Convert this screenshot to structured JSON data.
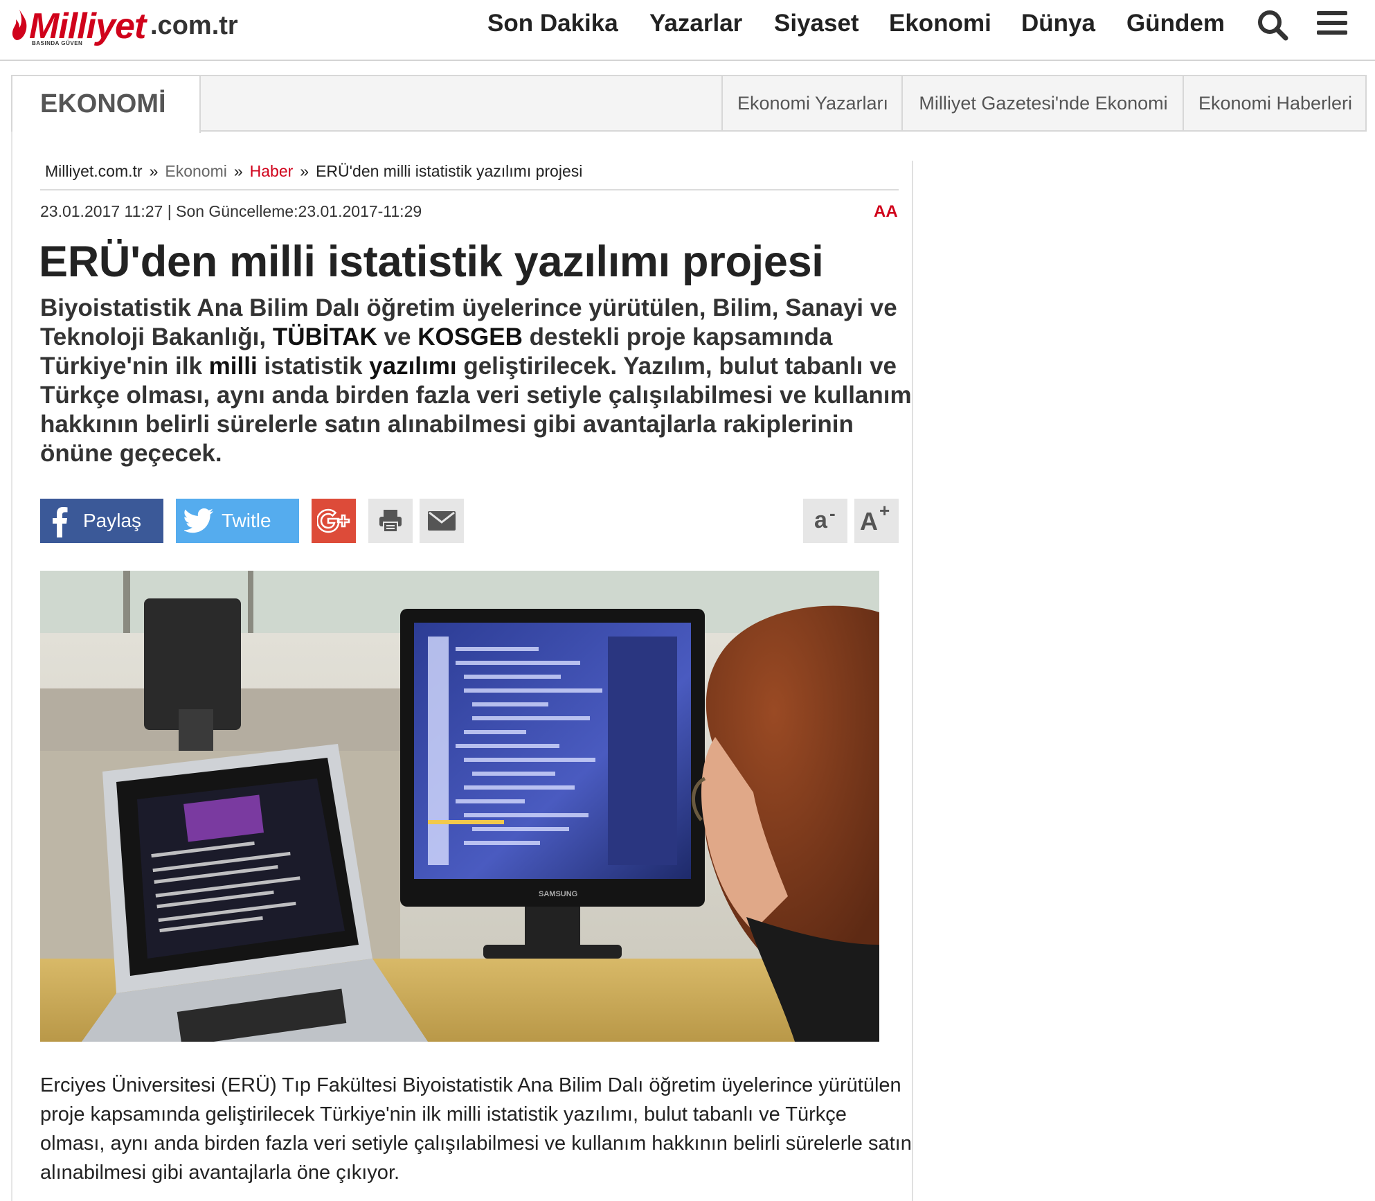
{
  "header": {
    "logo_brand": "Milliyet",
    "logo_tld": ".com.tr",
    "logo_motto": "BASINDA GÜVEN",
    "nav": [
      "Son Dakika",
      "Yazarlar",
      "Siyaset",
      "Ekonomi",
      "Dünya",
      "Gündem"
    ],
    "icons": [
      "search-icon",
      "menu-icon"
    ]
  },
  "category_bar": {
    "title": "EKONOMİ",
    "links": [
      "Ekonomi Yazarları",
      "Milliyet Gazetesi'nde Ekonomi",
      "Ekonomi Haberleri"
    ]
  },
  "breadcrumb": {
    "items": [
      "Milliyet.com.tr",
      "Ekonomi",
      "Haber",
      "ERÜ'den milli istatistik yazılımı projesi"
    ],
    "separator": "»"
  },
  "article": {
    "meta": "23.01.2017 11:27 | Son Güncelleme:23.01.2017-11:29",
    "font_toggle": "AA",
    "headline": "ERÜ'den milli istatistik yazılımı projesi",
    "summary_parts": {
      "p1": "Biyoistatistik Ana Bilim Dalı öğretim üyelerince yürütülen, Bilim, Sanayi ve Teknoloji Bakanlığı, ",
      "k1": "TÜBİTAK",
      "p2": " ve ",
      "k2": "KOSGEB",
      "p3": " destekli proje kapsamında Türkiye'nin ilk ",
      "k3": "milli",
      "p4": " istatistik ",
      "k4": "yazılımı",
      "p5": " geliştirilecek. Yazılım, bulut tabanlı ve Türkçe olması, aynı anda birden fazla veri setiyle çalışılabilmesi ve kullanım hakkının belirli sürelerle satın alınabilmesi gibi avantajlarla rakiplerinin önüne geçecek."
    },
    "body": "Erciyes Üniversitesi (ERÜ) Tıp Fakültesi Biyoistatistik Ana Bilim Dalı öğretim üyelerince yürütülen proje kapsamında geliştirilecek Türkiye'nin ilk milli istatistik yazılımı, bulut tabanlı ve Türkçe olması, aynı anda birden fazla veri setiyle çalışılabilmesi ve kullanım hakkının belirli sürelerle satın alınabilmesi gibi avantajlarla öne çıkıyor.",
    "monitor_brand": "SAMSUNG"
  },
  "share": {
    "facebook_label": "Paylaş",
    "twitter_label": "Twitle",
    "font_decrease": "a",
    "font_increase": "A",
    "colors": {
      "facebook": "#3b5998",
      "twitter": "#55acee",
      "google": "#dd4b39",
      "grey": "#e6e6e6"
    }
  }
}
